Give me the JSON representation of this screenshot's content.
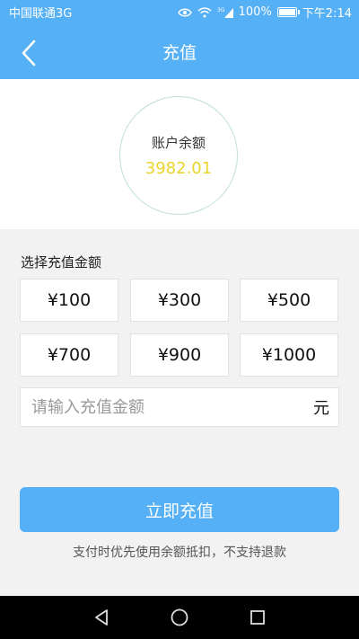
{
  "status_bar": {
    "carrier": "中国联通3G",
    "signal_tag": "3G",
    "battery": "100%",
    "time": "下午2:14"
  },
  "header": {
    "title": "充值"
  },
  "balance": {
    "label": "账户余额",
    "value": "3982.01"
  },
  "recharge": {
    "section_label": "选择充值金额",
    "options": [
      "¥100",
      "¥300",
      "¥500",
      "¥700",
      "¥900",
      "¥1000"
    ],
    "custom_placeholder": "请输入充值金额",
    "unit": "元",
    "submit_label": "立即充值",
    "notice": "支付时优先使用余额抵扣，不支持退款"
  },
  "colors": {
    "primary": "#56b0f5",
    "balance_value": "#e9d52b",
    "background": "#f2f2f2"
  }
}
